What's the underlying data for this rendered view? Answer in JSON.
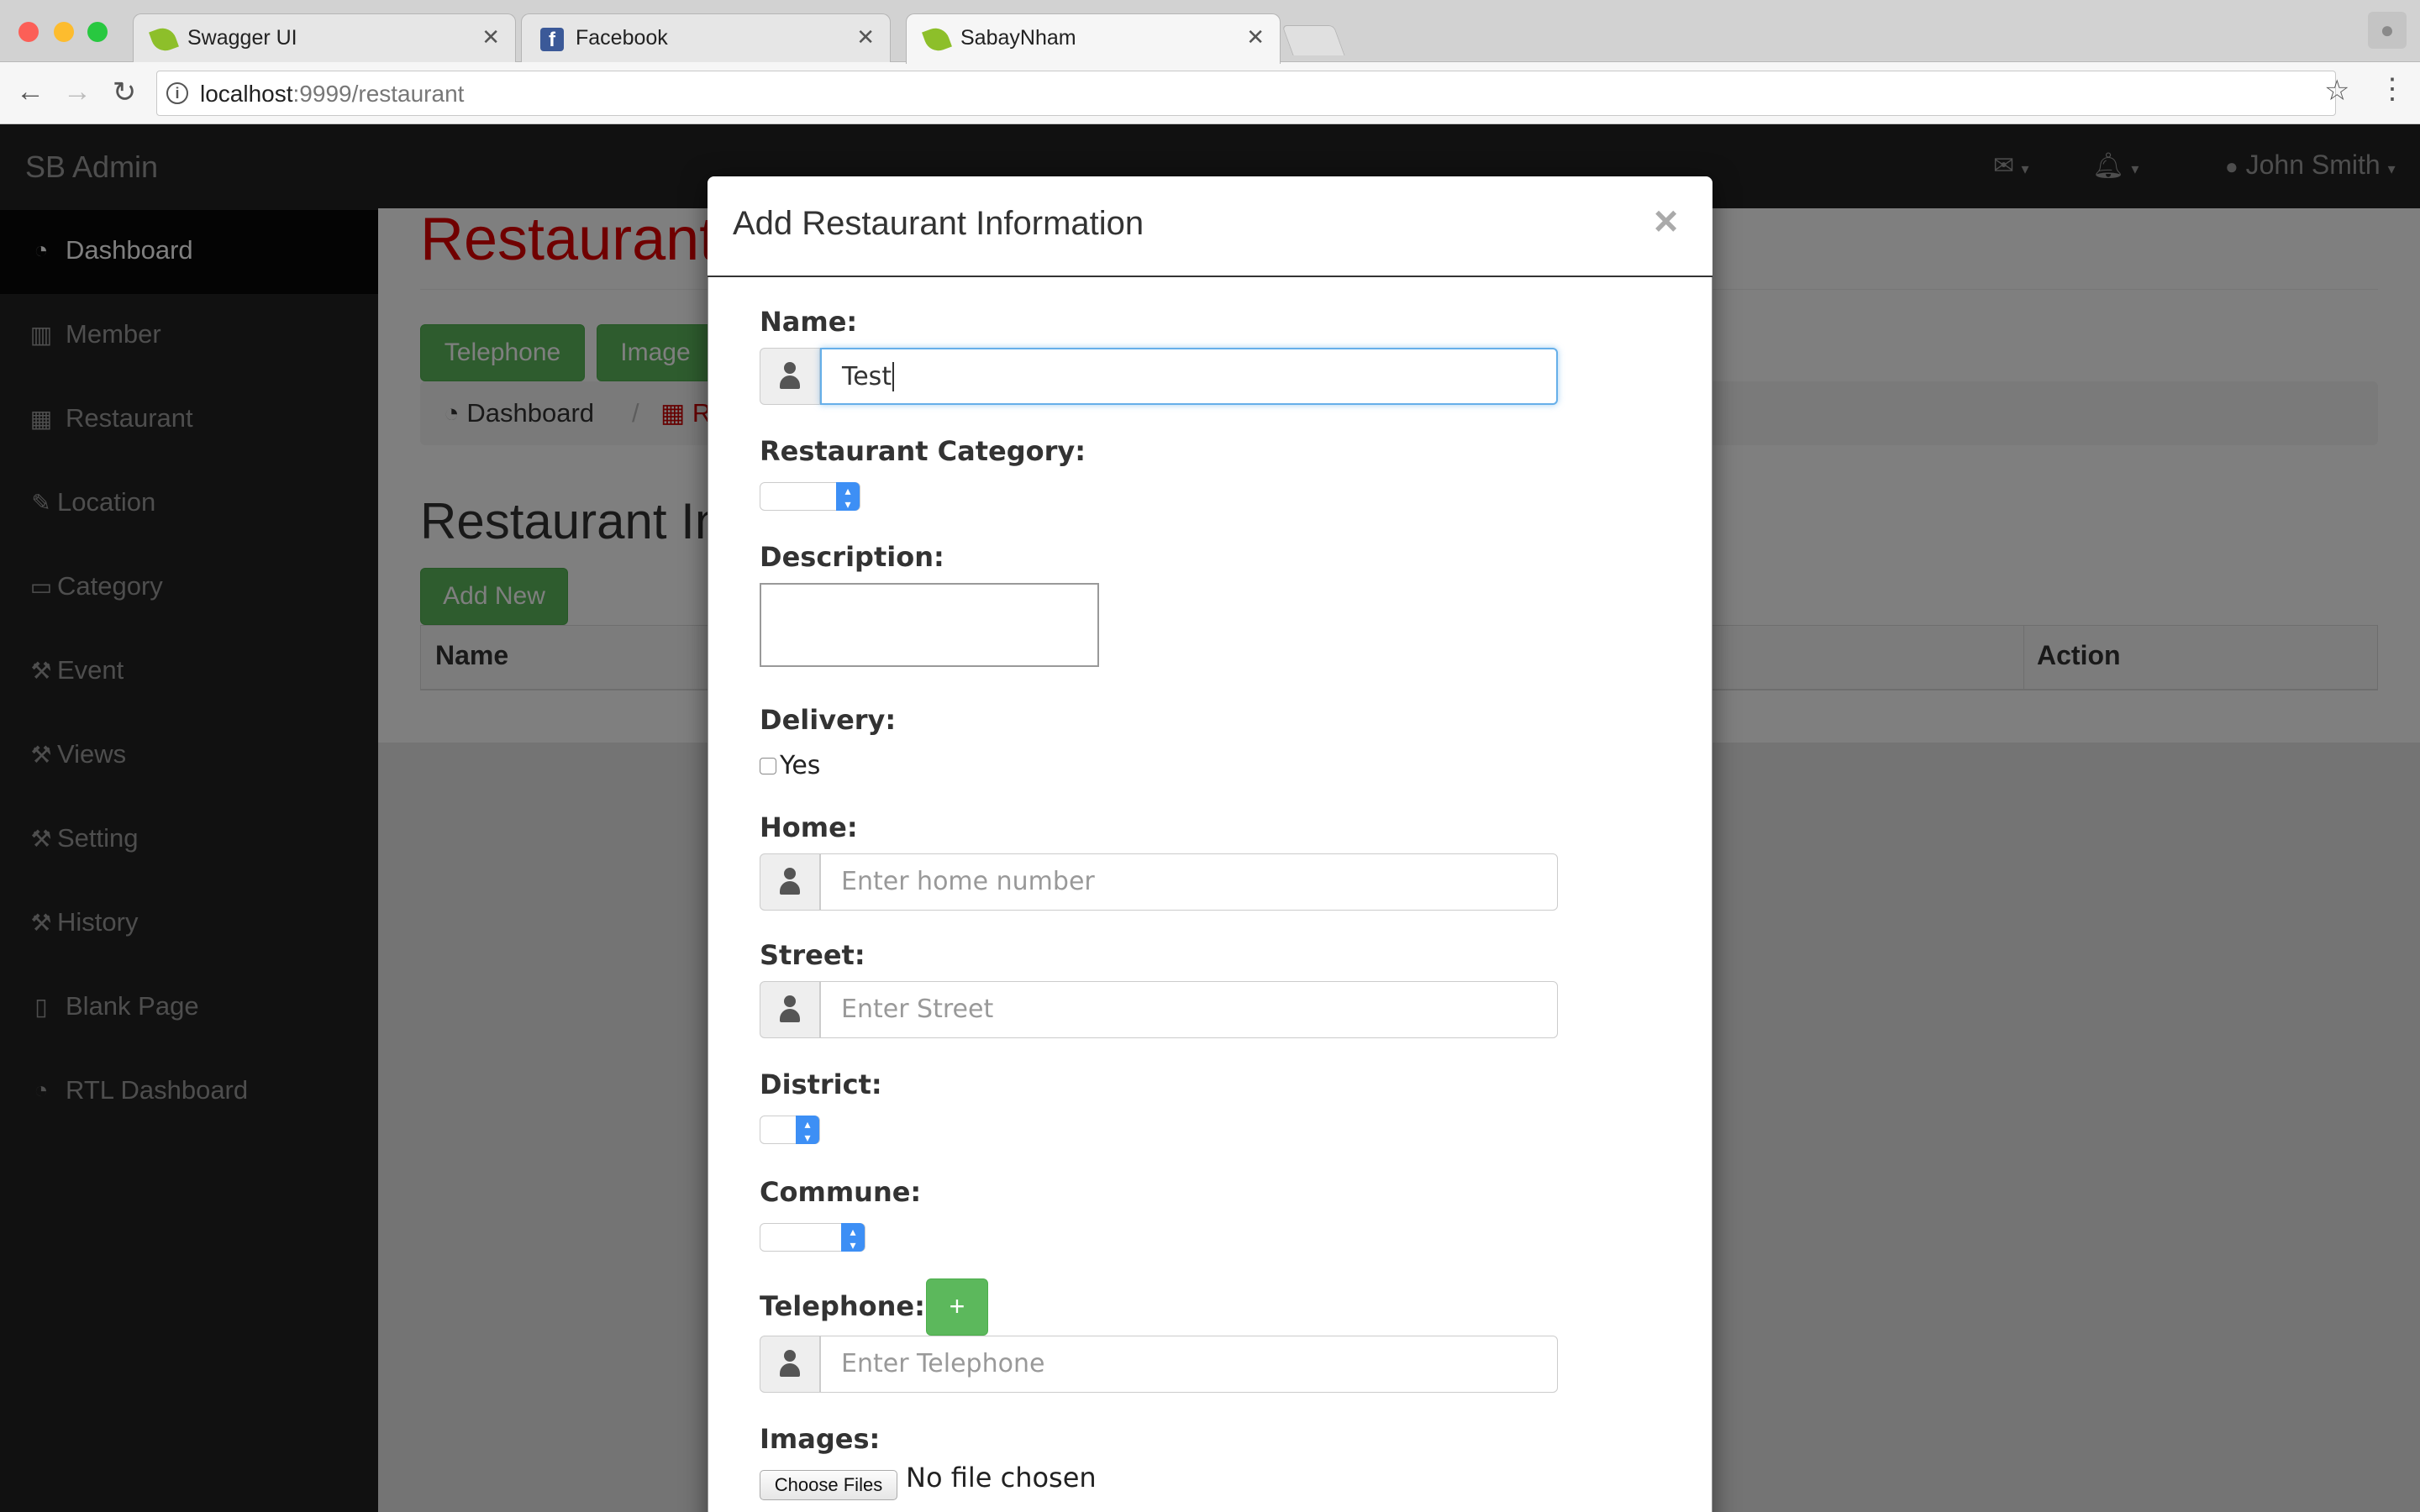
{
  "browser": {
    "tabs": [
      {
        "title": "Swagger UI",
        "icon": "leaf-icon"
      },
      {
        "title": "Facebook",
        "icon": "facebook-icon"
      },
      {
        "title": "SabayNham",
        "icon": "leaf-icon",
        "active": true
      }
    ],
    "url_host": "localhost",
    "url_path": ":9999/restaurant"
  },
  "app": {
    "brand": "SB Admin",
    "user_name": "John Smith",
    "sidebar": [
      {
        "label": "Dashboard",
        "icon": "dashboard-icon",
        "active": true
      },
      {
        "label": "Member",
        "icon": "bar-chart-icon"
      },
      {
        "label": "Restaurant",
        "icon": "table-icon"
      },
      {
        "label": "Location",
        "icon": "edit-icon"
      },
      {
        "label": "Category",
        "icon": "desktop-icon"
      },
      {
        "label": "Event",
        "icon": "wrench-icon"
      },
      {
        "label": "Views",
        "icon": "wrench-icon"
      },
      {
        "label": "Setting",
        "icon": "wrench-icon"
      },
      {
        "label": "History",
        "icon": "wrench-icon"
      },
      {
        "label": "Blank Page",
        "icon": "file-icon"
      },
      {
        "label": "RTL Dashboard",
        "icon": "dashboard-icon"
      }
    ],
    "page_heading": "Restaurant",
    "buttons": {
      "telephone": "Telephone",
      "image": "Image",
      "add_new": "Add New"
    },
    "breadcrumb": {
      "home": "Dashboard",
      "current": "R"
    },
    "section_heading": "Restaurant In",
    "table": {
      "columns": [
        "Name",
        "Action"
      ]
    }
  },
  "modal": {
    "title": "Add Restaurant Information",
    "close": "×",
    "name_label": "Name:",
    "name_value": "Test",
    "category_label": "Restaurant Category:",
    "description_label": "Description:",
    "delivery_label": "Delivery:",
    "delivery_option": "Yes",
    "delivery_checked": false,
    "home_label": "Home:",
    "home_placeholder": "Enter home number",
    "street_label": "Street:",
    "street_placeholder": "Enter Street",
    "district_label": "District:",
    "commune_label": "Commune:",
    "telephone_label": "Telephone:",
    "telephone_add": "+",
    "telephone_placeholder": "Enter Telephone",
    "images_label": "Images:",
    "choose_files": "Choose Files",
    "no_file": "No file chosen"
  },
  "colors": {
    "accent_green": "#5cb85c",
    "heading_red": "#e00000",
    "nav_dark": "#222222",
    "focus_blue": "#66afe9"
  }
}
